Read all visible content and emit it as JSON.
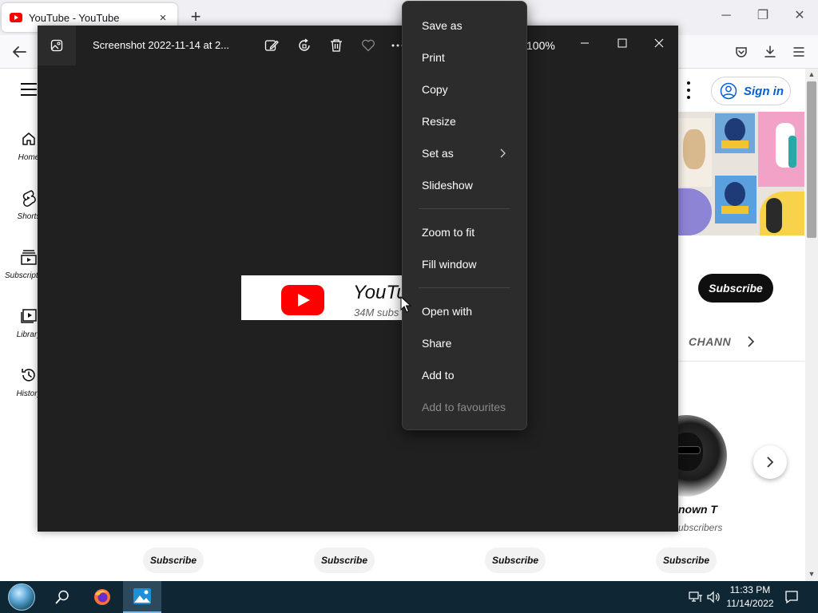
{
  "browser": {
    "tab_title": "YouTube - YouTube",
    "new_tab": "+",
    "close_tab": "×",
    "window": {
      "minimize": "─",
      "restore": "❐",
      "close": "✕"
    }
  },
  "youtube": {
    "sidebar": [
      {
        "label": "Home",
        "icon": "home-icon"
      },
      {
        "label": "Shorts",
        "icon": "shorts-icon"
      },
      {
        "label": "Subscriptions",
        "icon": "subscriptions-icon"
      },
      {
        "label": "Library",
        "icon": "library-icon"
      },
      {
        "label": "History",
        "icon": "history-icon"
      }
    ],
    "sign_in": "Sign in",
    "subscribe": "Subscribe",
    "channels_tab": "CHANN",
    "featured_channel": {
      "name": "nown T",
      "subscribers": "ubscribers"
    },
    "subscribe_pills": [
      "Subscribe",
      "Subscribe",
      "Subscribe",
      "Subscribe"
    ],
    "accent_color": "#ff0000"
  },
  "viewer": {
    "filename": "Screenshot 2022-11-14 at 2...",
    "zoom": "100%",
    "toolbar_icons": [
      "edit-image-icon",
      "rotate-icon",
      "delete-icon",
      "favorite-icon",
      "more-icon"
    ],
    "preview": {
      "title": "YouTu",
      "subscribers": "34M subs"
    }
  },
  "context_menu": {
    "items": [
      {
        "label": "Save as",
        "enabled": true
      },
      {
        "label": "Print",
        "enabled": true
      },
      {
        "label": "Copy",
        "enabled": true
      },
      {
        "label": "Resize",
        "enabled": true
      },
      {
        "label": "Set as",
        "enabled": true,
        "submenu": true
      },
      {
        "label": "Slideshow",
        "enabled": true
      },
      {
        "label": "Zoom to fit",
        "enabled": true
      },
      {
        "label": "Fill window",
        "enabled": true
      },
      {
        "label": "Open with",
        "enabled": true
      },
      {
        "label": "Share",
        "enabled": true
      },
      {
        "label": "Add to",
        "enabled": true
      },
      {
        "label": "Add to favourites",
        "enabled": false
      }
    ]
  },
  "taskbar": {
    "time": "11:33 PM",
    "date": "11/14/2022",
    "pinned": [
      "firefox-icon",
      "photos-icon"
    ],
    "tray": [
      "network-icon",
      "volume-icon",
      "notifications-icon"
    ]
  }
}
